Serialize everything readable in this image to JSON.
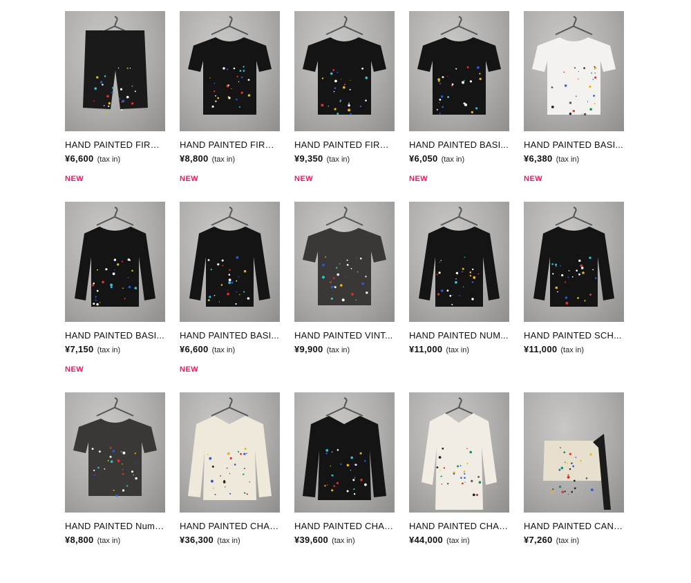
{
  "products": [
    {
      "title": "HAND PAINTED FIRM ...",
      "price": "¥6,600",
      "tax": "(tax in)",
      "badge": "NEW",
      "icon": "shorts-icon",
      "color": "#1a1a1a"
    },
    {
      "title": "HAND PAINTED FIRM ...",
      "price": "¥8,800",
      "tax": "(tax in)",
      "badge": "NEW",
      "icon": "tshirt-icon",
      "color": "#141414"
    },
    {
      "title": "HAND PAINTED FIRM ...",
      "price": "¥9,350",
      "tax": "(tax in)",
      "badge": "NEW",
      "icon": "tshirt-icon",
      "color": "#141414"
    },
    {
      "title": "HAND PAINTED BASI...",
      "price": "¥6,050",
      "tax": "(tax in)",
      "badge": "NEW",
      "icon": "tshirt-icon",
      "color": "#141414"
    },
    {
      "title": "HAND PAINTED BASI...",
      "price": "¥6,380",
      "tax": "(tax in)",
      "badge": "NEW",
      "icon": "tshirt-icon",
      "color": "#f4f2ee"
    },
    {
      "title": "HAND PAINTED BASI...",
      "price": "¥7,150",
      "tax": "(tax in)",
      "badge": "NEW",
      "icon": "longsleeve-icon",
      "color": "#141414"
    },
    {
      "title": "HAND PAINTED BASI...",
      "price": "¥6,600",
      "tax": "(tax in)",
      "badge": "NEW",
      "icon": "longsleeve-icon",
      "color": "#141414"
    },
    {
      "title": "HAND PAINTED VINT...",
      "price": "¥9,900",
      "tax": "(tax in)",
      "badge": "",
      "icon": "tshirt-icon",
      "color": "#3a3836"
    },
    {
      "title": "HAND PAINTED NUM...",
      "price": "¥11,000",
      "tax": "(tax in)",
      "badge": "",
      "icon": "longsleeve-icon",
      "color": "#141414"
    },
    {
      "title": "HAND PAINTED SCH...",
      "price": "¥11,000",
      "tax": "(tax in)",
      "badge": "",
      "icon": "longsleeve-icon",
      "color": "#141414"
    },
    {
      "title": "HAND PAINTED Numb...",
      "price": "¥8,800",
      "tax": "(tax in)",
      "badge": "",
      "icon": "tshirt-icon",
      "color": "#3a3836"
    },
    {
      "title": "HAND PAINTED CHAI...",
      "price": "¥36,300",
      "tax": "(tax in)",
      "badge": "",
      "icon": "jacket-icon",
      "color": "#efe9dc"
    },
    {
      "title": "HAND PAINTED CHAI...",
      "price": "¥39,600",
      "tax": "(tax in)",
      "badge": "",
      "icon": "jacket-icon",
      "color": "#141414"
    },
    {
      "title": "HAND PAINTED CHAI...",
      "price": "¥44,000",
      "tax": "(tax in)",
      "badge": "",
      "icon": "coat-icon",
      "color": "#f1ede4"
    },
    {
      "title": "HAND PAINTED CANV...",
      "price": "¥7,260",
      "tax": "(tax in)",
      "badge": "",
      "icon": "bag-icon",
      "color": "#e8e0cf"
    }
  ]
}
